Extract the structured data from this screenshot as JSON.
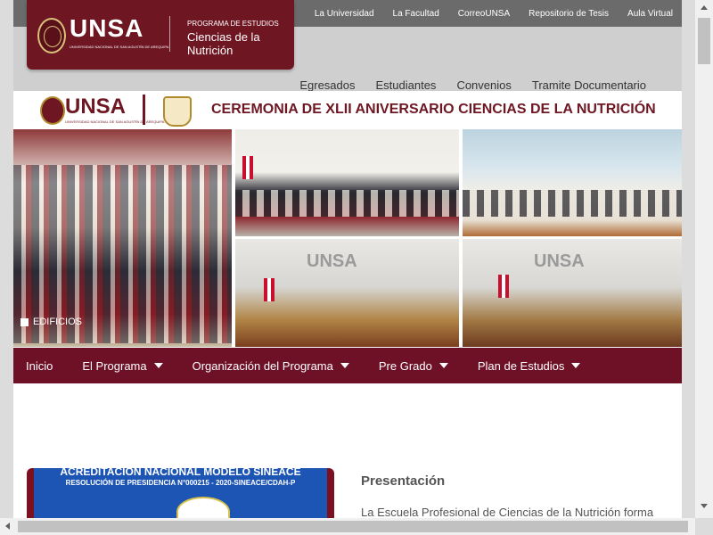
{
  "topnav": [
    "La Universidad",
    "La Facultad",
    "CorreoUNSA",
    "Repositorio de Tesis",
    "Aula Virtual"
  ],
  "logo": {
    "wordmark": "UNSA",
    "subtext": "UNIVERSIDAD NACIONAL DE SAN AGUSTÍN DE AREQUIPA",
    "program_label": "PROGRAMA DE ESTUDIOS",
    "program_name": "Ciencias de la Nutrición"
  },
  "mainnav": [
    "Egresados",
    "Estudiantes",
    "Convenios",
    "Tramite Documentario"
  ],
  "banner": {
    "wordmark": "UNSA",
    "subtext": "UNIVERSIDAD NACIONAL DE SAN AGUSTÍN DE AREQUIPA",
    "title": "CEREMONIA DE XLII ANIVERSARIO CIENCIAS DE LA NUTRICIÓN"
  },
  "collage": {
    "stage_logo": "UNSA",
    "caption": "EDIFICIOS"
  },
  "menu": [
    {
      "label": "Inicio",
      "dropdown": false
    },
    {
      "label": "El Programa",
      "dropdown": true
    },
    {
      "label": "Organización del Programa",
      "dropdown": true
    },
    {
      "label": "Pre Grado",
      "dropdown": true
    },
    {
      "label": "Plan de Estudios",
      "dropdown": true
    }
  ],
  "accreditation": {
    "title": "ACREDITACIÓN NACIONAL MODELO SINEACE",
    "resolution": "RESOLUCIÓN DE PRESIDENCIA N°000215 - 2020-SINEACE/CDAH-P"
  },
  "presentation": {
    "title": "Presentación",
    "text": "La Escuela Profesional de Ciencias de la Nutrición forma"
  },
  "colors": {
    "brand": "#6e1723",
    "menu_bg": "#6e1026",
    "topbar_bg": "#6b6b6b"
  }
}
